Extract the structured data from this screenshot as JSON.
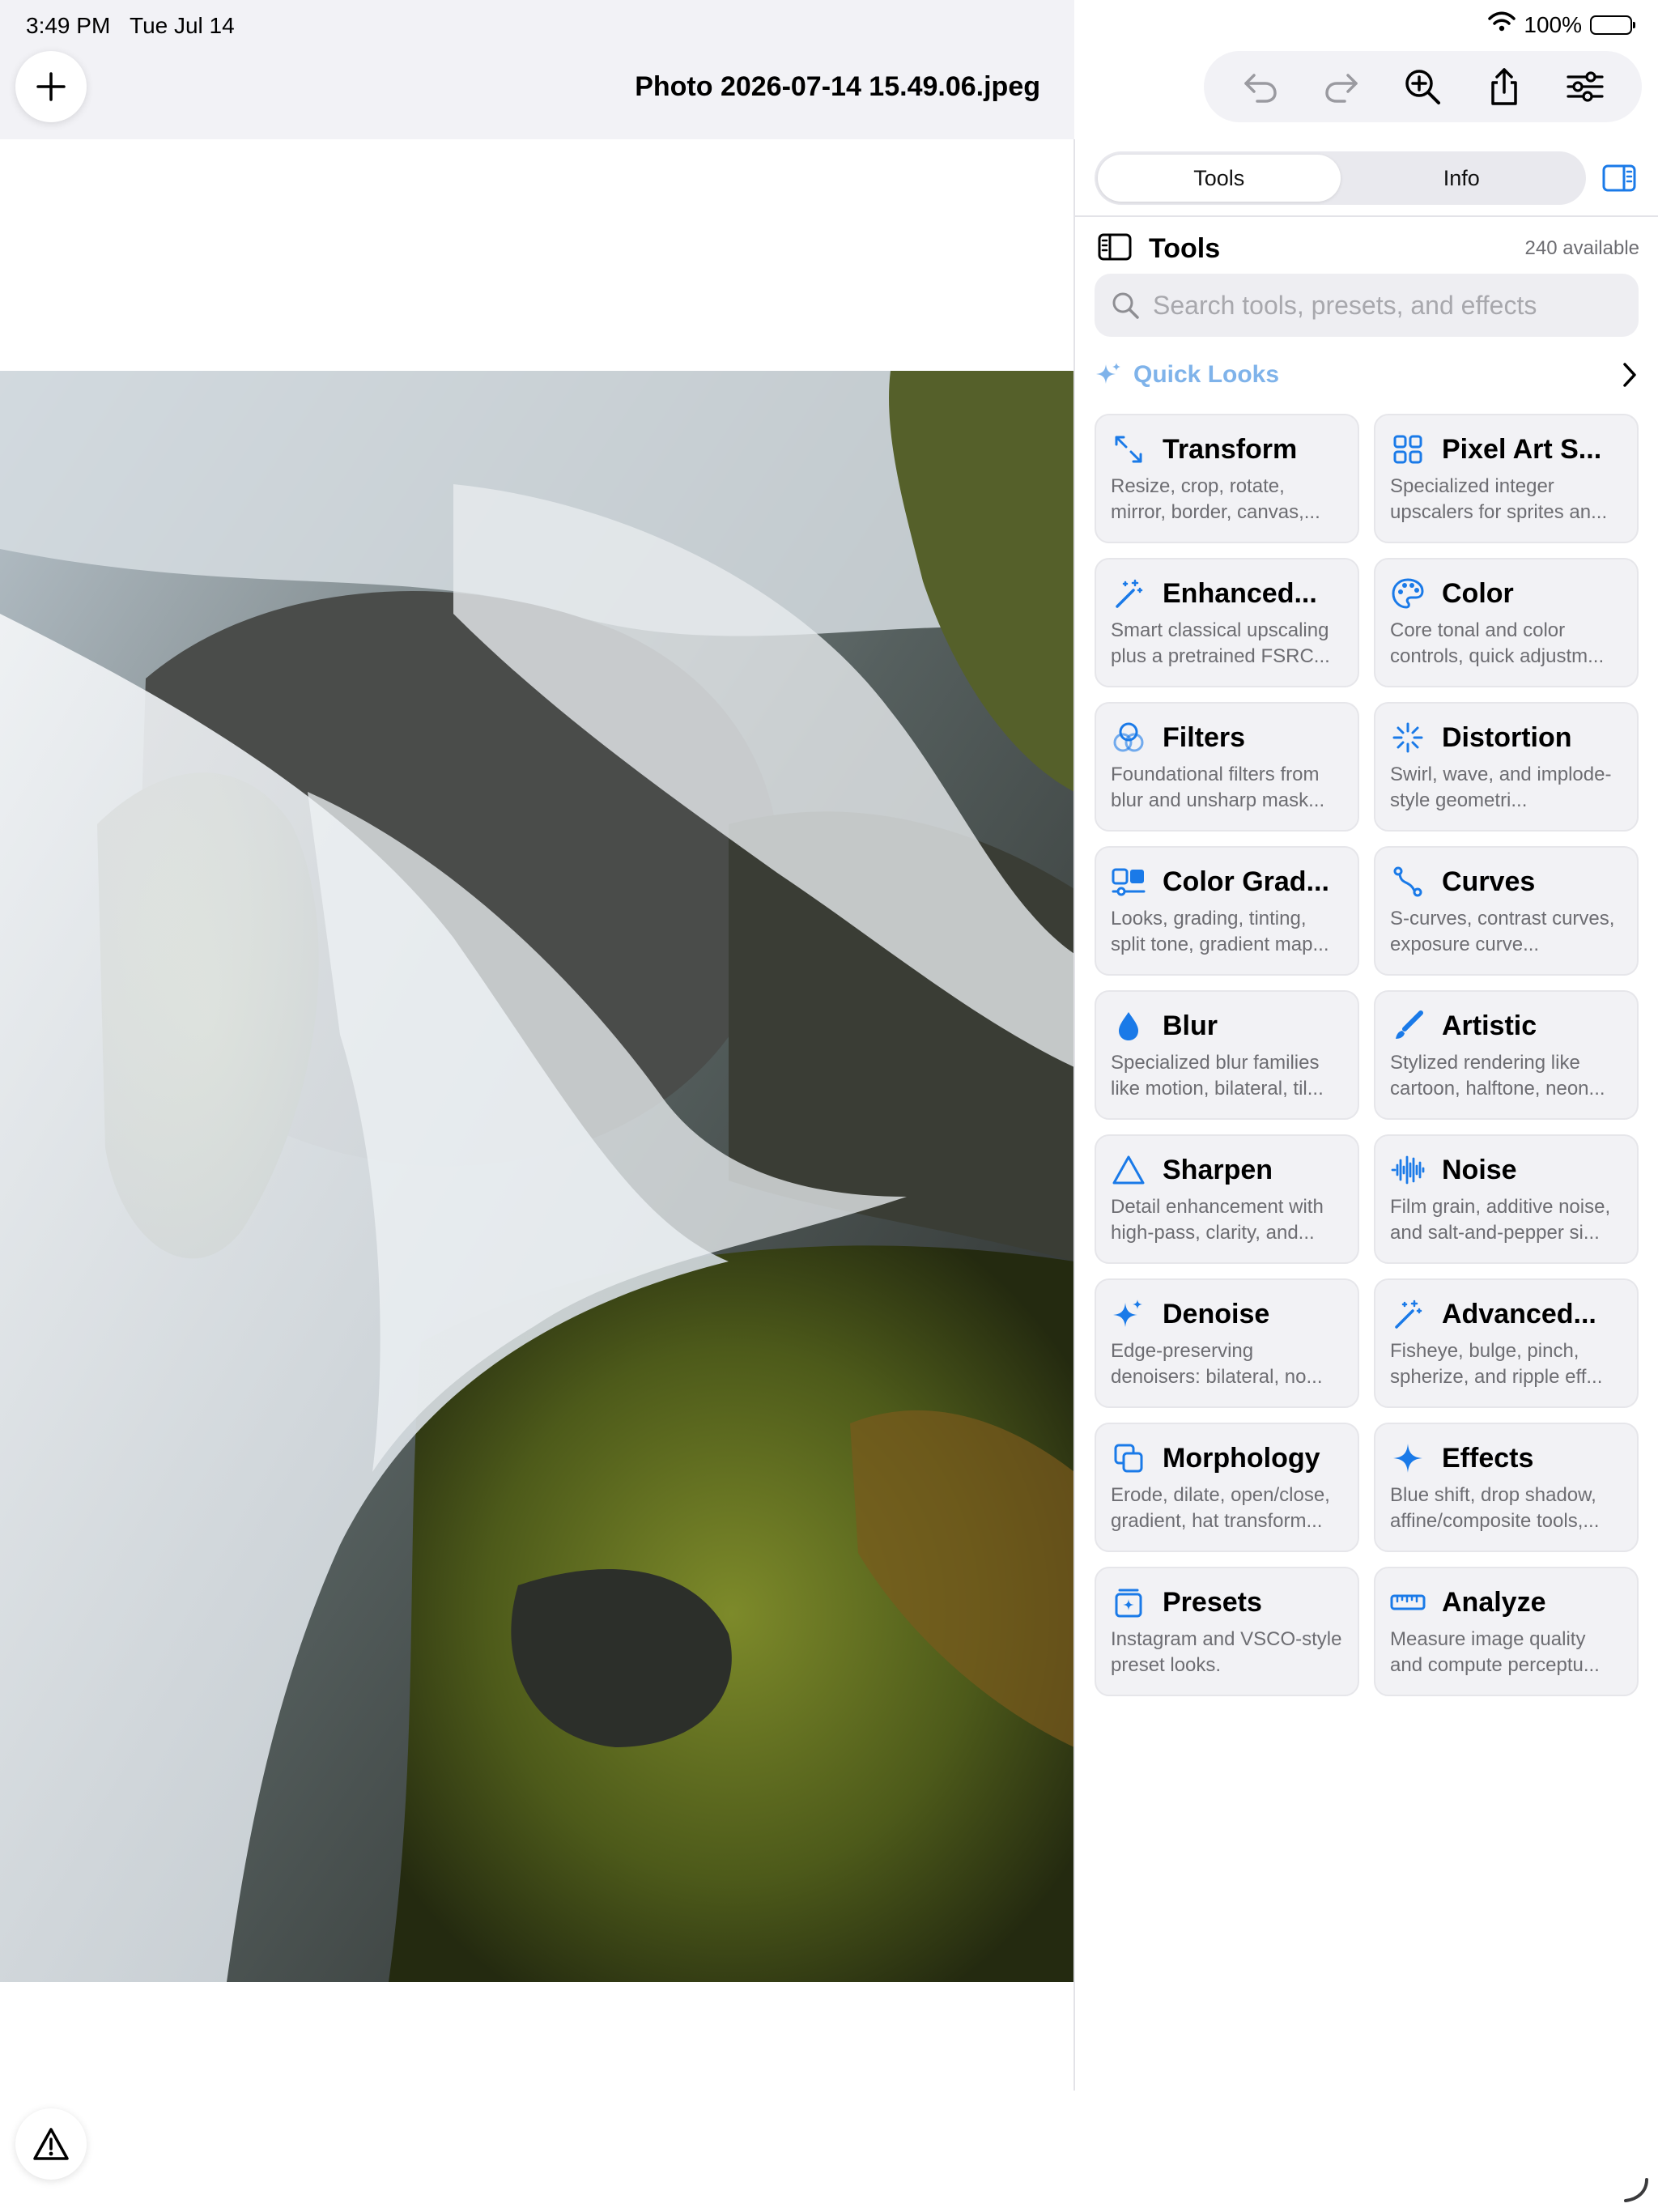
{
  "status_bar": {
    "time": "3:49 PM",
    "date": "Tue Jul 14",
    "battery": "100%"
  },
  "document": {
    "title": "Photo 2026-07-14 15.49.06.jpeg"
  },
  "sidebar": {
    "segments": [
      "Tools",
      "Info"
    ],
    "active_segment": "Tools",
    "header_title": "Tools",
    "count_label": "240 available",
    "search_placeholder": "Search tools, presets, and effects",
    "search_value": "",
    "quick_looks_label": "Quick Looks",
    "accent_color": "#1a7ae8",
    "cards": [
      {
        "icon": "transform-icon",
        "name": "Transform",
        "desc": "Resize, crop, rotate, mirror, border, canvas,..."
      },
      {
        "icon": "grid-icon",
        "name": "Pixel Art S...",
        "desc": "Specialized integer upscalers for sprites an..."
      },
      {
        "icon": "magic-wand-icon",
        "name": "Enhanced...",
        "desc": "Smart classical upscaling plus a pretrained FSRC..."
      },
      {
        "icon": "palette-icon",
        "name": "Color",
        "desc": "Core tonal and color controls, quick adjustm..."
      },
      {
        "icon": "filters-icon",
        "name": "Filters",
        "desc": "Foundational filters from blur and unsharp mask..."
      },
      {
        "icon": "distortion-icon",
        "name": "Distortion",
        "desc": "Swirl, wave, and implode-style geometri..."
      },
      {
        "icon": "color-grading-icon",
        "name": "Color Grad...",
        "desc": "Looks, grading, tinting, split tone, gradient map..."
      },
      {
        "icon": "curves-icon",
        "name": "Curves",
        "desc": "S-curves, contrast curves, exposure curve..."
      },
      {
        "icon": "drop-icon",
        "name": "Blur",
        "desc": "Specialized blur families like motion, bilateral, til..."
      },
      {
        "icon": "brush-icon",
        "name": "Artistic",
        "desc": "Stylized rendering like cartoon, halftone, neon..."
      },
      {
        "icon": "triangle-icon",
        "name": "Sharpen",
        "desc": "Detail enhancement with high-pass, clarity, and..."
      },
      {
        "icon": "waveform-icon",
        "name": "Noise",
        "desc": "Film grain, additive noise, and salt-and-pepper si..."
      },
      {
        "icon": "sparkles-icon",
        "name": "Denoise",
        "desc": "Edge-preserving denoisers: bilateral, no..."
      },
      {
        "icon": "magic-wand-icon",
        "name": "Advanced...",
        "desc": "Fisheye, bulge, pinch, spherize, and ripple eff..."
      },
      {
        "icon": "morphology-icon",
        "name": "Morphology",
        "desc": "Erode, dilate, open/close, gradient, hat transform..."
      },
      {
        "icon": "sparkle-icon",
        "name": "Effects",
        "desc": "Blue shift, drop shadow, affine/composite tools,..."
      },
      {
        "icon": "presets-icon",
        "name": "Presets",
        "desc": "Instagram and VSCO-style preset looks."
      },
      {
        "icon": "ruler-icon",
        "name": "Analyze",
        "desc": "Measure image quality and compute perceptu..."
      }
    ]
  }
}
